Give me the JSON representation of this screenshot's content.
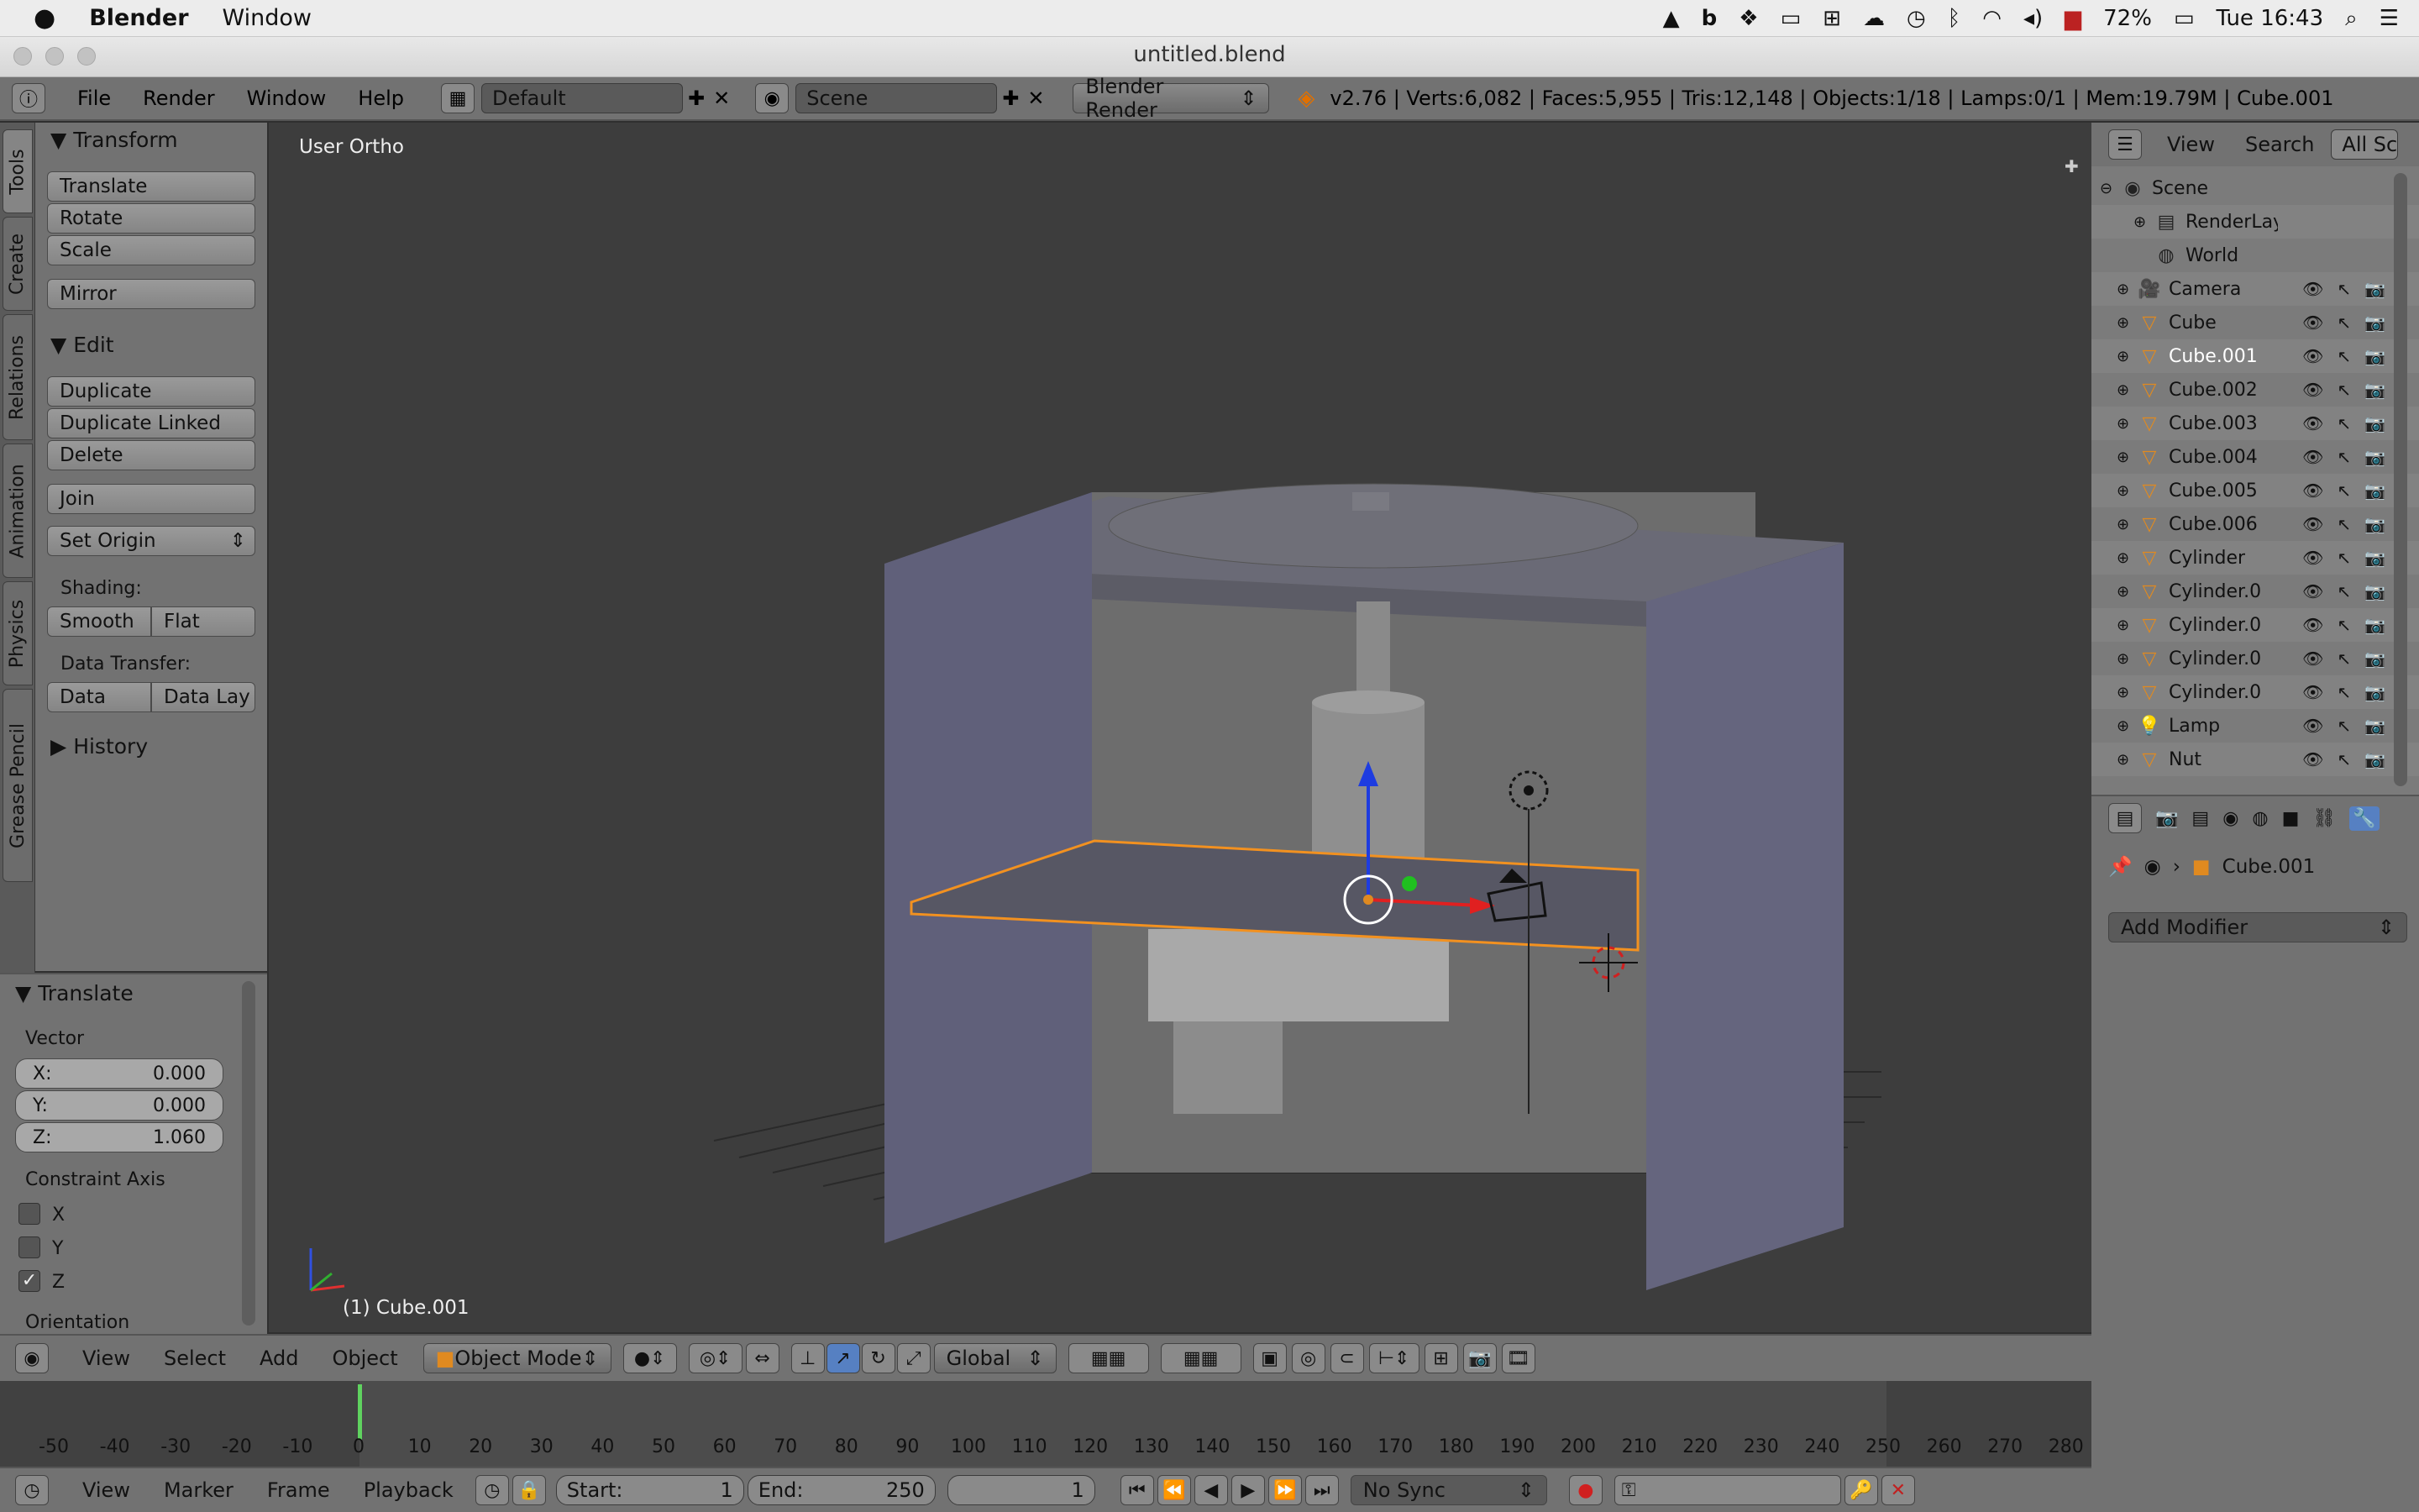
{
  "menubar": {
    "apple": "",
    "app": "Blender",
    "window": "Window",
    "battery": "72%",
    "clock": "Tue 16:43"
  },
  "window": {
    "title": "untitled.blend"
  },
  "info_header": {
    "menus": [
      "File",
      "Render",
      "Window",
      "Help"
    ],
    "layout": "Default",
    "scene": "Scene",
    "engine": "Blender Render",
    "stats": "v2.76 | Verts:6,082 | Faces:5,955 | Tris:12,148 | Objects:1/18 | Lamps:0/1 | Mem:19.79M | Cube.001"
  },
  "left_tabs": [
    "Tools",
    "Create",
    "Relations",
    "Animation",
    "Physics",
    "Grease Pencil"
  ],
  "tool_panel": {
    "transform_title": "Transform",
    "translate": "Translate",
    "rotate": "Rotate",
    "scale": "Scale",
    "mirror": "Mirror",
    "edit_title": "Edit",
    "duplicate": "Duplicate",
    "duplicate_linked": "Duplicate Linked",
    "delete": "Delete",
    "join": "Join",
    "set_origin": "Set Origin",
    "shading_label": "Shading:",
    "smooth": "Smooth",
    "flat": "Flat",
    "data_transfer_label": "Data Transfer:",
    "data": "Data",
    "data_lay": "Data Lay",
    "history_title": "History"
  },
  "operator_panel": {
    "title": "Translate",
    "vector_label": "Vector",
    "x_label": "X:",
    "x_value": "0.000",
    "y_label": "Y:",
    "y_value": "0.000",
    "z_label": "Z:",
    "z_value": "1.060",
    "constraint_label": "Constraint Axis",
    "cx": "X",
    "cy": "Y",
    "cz": "Z",
    "orientation_label": "Orientation"
  },
  "viewport": {
    "view_label": "User Ortho",
    "object_label": "(1) Cube.001"
  },
  "outliner": {
    "view": "View",
    "search": "Search",
    "all_scenes": "All Sce",
    "items": [
      {
        "name": "Scene",
        "type": "scene"
      },
      {
        "name": "RenderLay",
        "type": "renderlayer"
      },
      {
        "name": "World",
        "type": "world"
      },
      {
        "name": "Camera",
        "type": "camera"
      },
      {
        "name": "Cube",
        "type": "mesh"
      },
      {
        "name": "Cube.001",
        "type": "mesh",
        "selected": true
      },
      {
        "name": "Cube.002",
        "type": "mesh"
      },
      {
        "name": "Cube.003",
        "type": "mesh"
      },
      {
        "name": "Cube.004",
        "type": "mesh"
      },
      {
        "name": "Cube.005",
        "type": "mesh"
      },
      {
        "name": "Cube.006",
        "type": "mesh"
      },
      {
        "name": "Cylinder",
        "type": "mesh"
      },
      {
        "name": "Cylinder.0",
        "type": "mesh"
      },
      {
        "name": "Cylinder.0",
        "type": "mesh"
      },
      {
        "name": "Cylinder.0",
        "type": "mesh"
      },
      {
        "name": "Cylinder.0",
        "type": "mesh"
      },
      {
        "name": "Lamp",
        "type": "lamp"
      },
      {
        "name": "Nut",
        "type": "mesh"
      }
    ]
  },
  "properties": {
    "object_name": "Cube.001",
    "add_modifier": "Add Modifier"
  },
  "viewport_header": {
    "view": "View",
    "select": "Select",
    "add": "Add",
    "object": "Object",
    "mode": "Object Mode",
    "orientation": "Global"
  },
  "timeline": {
    "ticks": [
      "-50",
      "-40",
      "-30",
      "-20",
      "-10",
      "0",
      "10",
      "20",
      "30",
      "40",
      "50",
      "60",
      "70",
      "80",
      "90",
      "100",
      "110",
      "120",
      "130",
      "140",
      "150",
      "160",
      "170",
      "180",
      "190",
      "200",
      "210",
      "220",
      "230",
      "240",
      "250",
      "260",
      "270",
      "280"
    ]
  },
  "timeline_header": {
    "view": "View",
    "marker": "Marker",
    "frame": "Frame",
    "playback": "Playback",
    "start_label": "Start:",
    "start_value": "1",
    "end_label": "End:",
    "end_value": "250",
    "current_frame": "1",
    "sync": "No Sync"
  }
}
